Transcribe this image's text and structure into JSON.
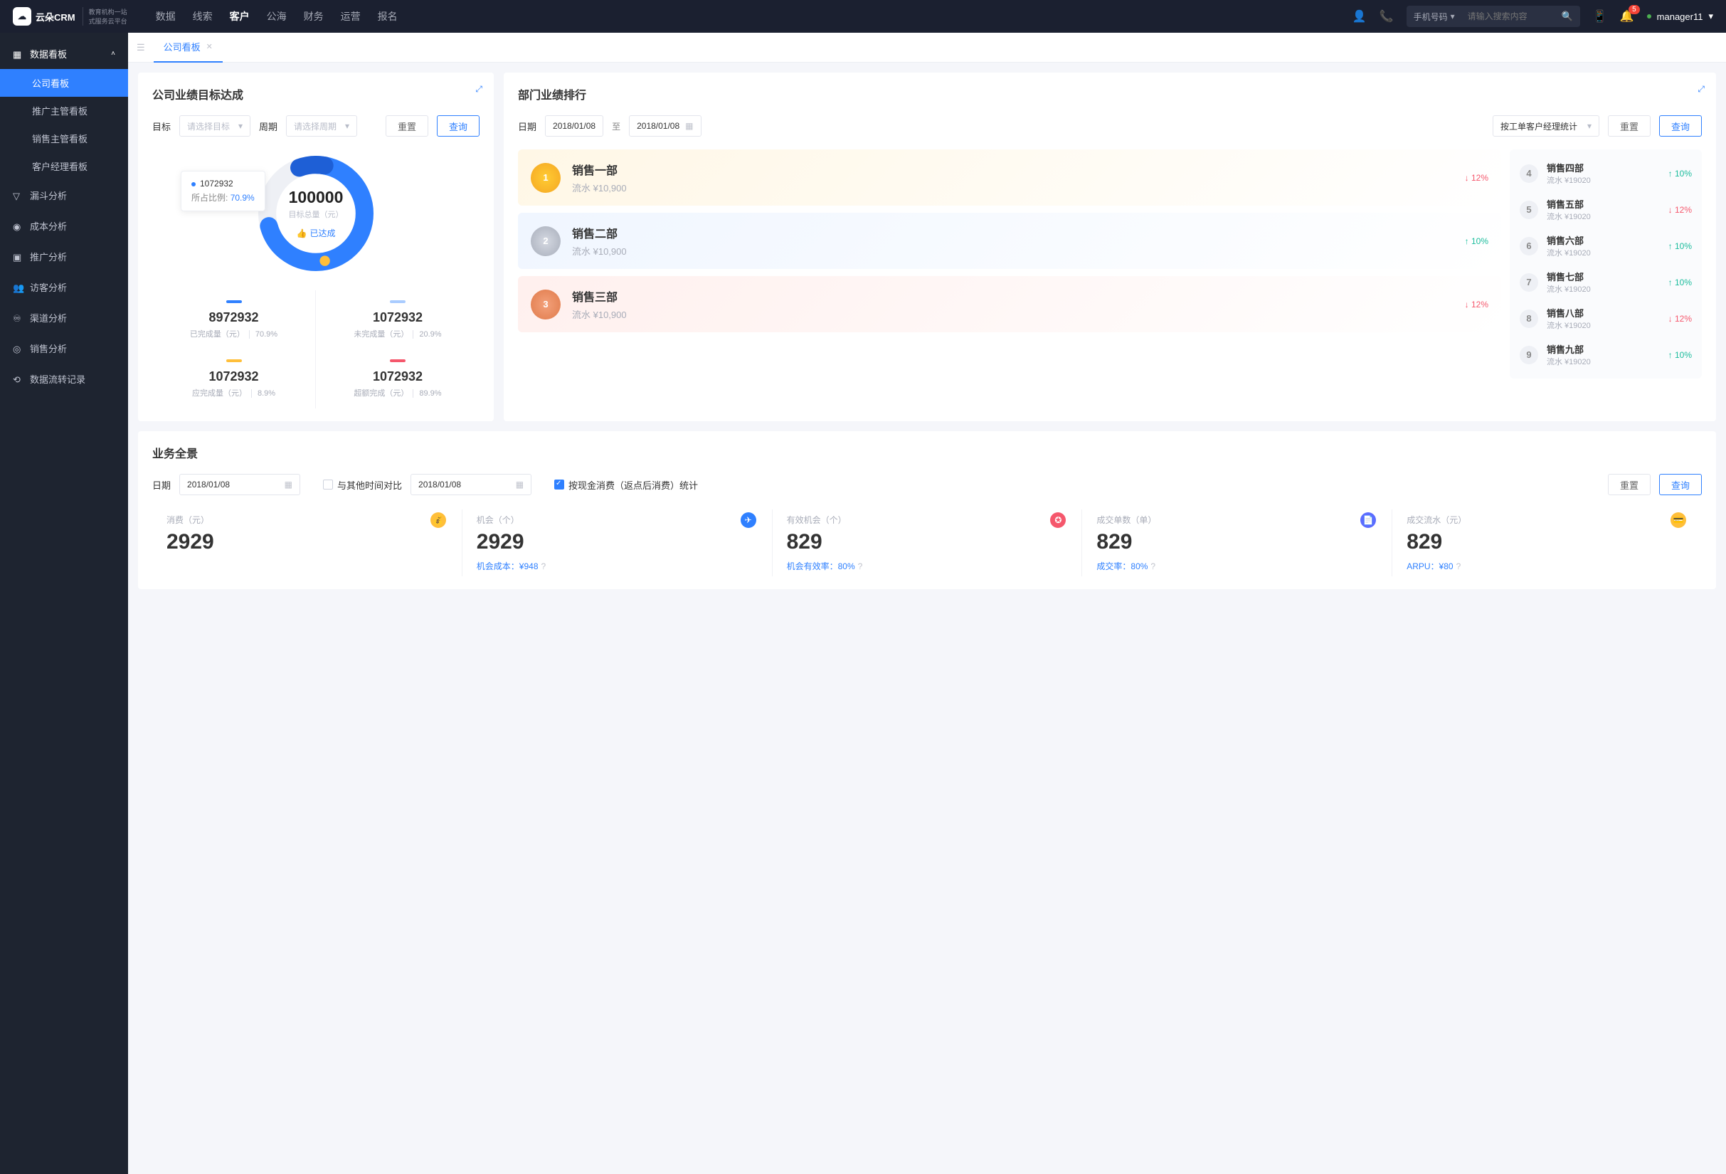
{
  "brand": {
    "name": "云朵CRM",
    "sub1": "教育机构一站",
    "sub2": "式服务云平台"
  },
  "topnav": [
    "数据",
    "线索",
    "客户",
    "公海",
    "财务",
    "运营",
    "报名"
  ],
  "topnav_active": 2,
  "search": {
    "type": "手机号码",
    "placeholder": "请输入搜索内容"
  },
  "notif_count": "5",
  "username": "manager11",
  "sidebar": {
    "group": "数据看板",
    "subs": [
      "公司看板",
      "推广主管看板",
      "销售主管看板",
      "客户经理看板"
    ],
    "active_sub": 0,
    "items": [
      "漏斗分析",
      "成本分析",
      "推广分析",
      "访客分析",
      "渠道分析",
      "销售分析",
      "数据流转记录"
    ]
  },
  "tab": {
    "label": "公司看板"
  },
  "panel1": {
    "title": "公司业绩目标达成",
    "labels": {
      "target": "目标",
      "period": "周期",
      "target_ph": "请选择目标",
      "period_ph": "请选择周期",
      "reset": "重置",
      "query": "查询"
    },
    "tooltip": {
      "value": "1072932",
      "ratio_label": "所占比例:",
      "ratio": "70.9%"
    },
    "center": {
      "num": "100000",
      "lbl": "目标总量（元）",
      "reached": "已达成"
    },
    "stats": [
      {
        "dash": "#2f80ff",
        "num": "8972932",
        "lbl": "已完成量（元）",
        "pct": "70.9%"
      },
      {
        "dash": "#a9ccff",
        "num": "1072932",
        "lbl": "未完成量（元）",
        "pct": "20.9%"
      },
      {
        "dash": "#ffbf3a",
        "num": "1072932",
        "lbl": "应完成量（元）",
        "pct": "8.9%"
      },
      {
        "dash": "#f5576c",
        "num": "1072932",
        "lbl": "超额完成（元）",
        "pct": "89.9%"
      }
    ]
  },
  "panel2": {
    "title": "部门业绩排行",
    "labels": {
      "date": "日期",
      "to": "至",
      "reset": "重置",
      "query": "查询"
    },
    "date1": "2018/01/08",
    "date2": "2018/01/08",
    "stat_by": "按工单客户经理统计",
    "top3": [
      {
        "name": "销售一部",
        "flow": "流水 ¥10,900",
        "trend": "down",
        "pct": "12%"
      },
      {
        "name": "销售二部",
        "flow": "流水 ¥10,900",
        "trend": "up",
        "pct": "10%"
      },
      {
        "name": "销售三部",
        "flow": "流水 ¥10,900",
        "trend": "down",
        "pct": "12%"
      }
    ],
    "rest": [
      {
        "rank": "4",
        "name": "销售四部",
        "flow": "流水 ¥19020",
        "trend": "up",
        "pct": "10%"
      },
      {
        "rank": "5",
        "name": "销售五部",
        "flow": "流水 ¥19020",
        "trend": "down",
        "pct": "12%"
      },
      {
        "rank": "6",
        "name": "销售六部",
        "flow": "流水 ¥19020",
        "trend": "up",
        "pct": "10%"
      },
      {
        "rank": "7",
        "name": "销售七部",
        "flow": "流水 ¥19020",
        "trend": "up",
        "pct": "10%"
      },
      {
        "rank": "8",
        "name": "销售八部",
        "flow": "流水 ¥19020",
        "trend": "down",
        "pct": "12%"
      },
      {
        "rank": "9",
        "name": "销售九部",
        "flow": "流水 ¥19020",
        "trend": "up",
        "pct": "10%"
      }
    ]
  },
  "panel3": {
    "title": "业务全景",
    "labels": {
      "date": "日期",
      "compare": "与其他时间对比",
      "afterrebate": "按现金消费（返点后消费）统计",
      "reset": "重置",
      "query": "查询"
    },
    "date1": "2018/01/08",
    "date2": "2018/01/08",
    "metrics": [
      {
        "label": "消费（元）",
        "value": "2929",
        "sub": "",
        "iconbg": "#ffbf3a",
        "icon": "💰"
      },
      {
        "label": "机会（个）",
        "value": "2929",
        "sub": "机会成本：¥948",
        "iconbg": "#2f80ff",
        "icon": "✈"
      },
      {
        "label": "有效机会（个）",
        "value": "829",
        "sub": "机会有效率：80%",
        "iconbg": "#f5576c",
        "icon": "✪"
      },
      {
        "label": "成交单数（单）",
        "value": "829",
        "sub": "成交率：80%",
        "iconbg": "#5b6cff",
        "icon": "📄"
      },
      {
        "label": "成交流水（元）",
        "value": "829",
        "sub": "ARPU：¥80",
        "iconbg": "#ffbf3a",
        "icon": "💳"
      }
    ]
  },
  "chart_data": {
    "type": "pie",
    "title": "目标总量（元）",
    "total": 100000,
    "series": [
      {
        "name": "已完成量（元）",
        "value": 8972932,
        "pct": 70.9,
        "color": "#2f80ff"
      },
      {
        "name": "未完成量（元）",
        "value": 1072932,
        "pct": 20.9,
        "color": "#a9ccff"
      },
      {
        "name": "应完成量（元）",
        "value": 1072932,
        "pct": 8.9,
        "color": "#ffbf3a"
      },
      {
        "name": "超额完成（元）",
        "value": 1072932,
        "pct": 89.9,
        "color": "#f5576c"
      }
    ]
  }
}
